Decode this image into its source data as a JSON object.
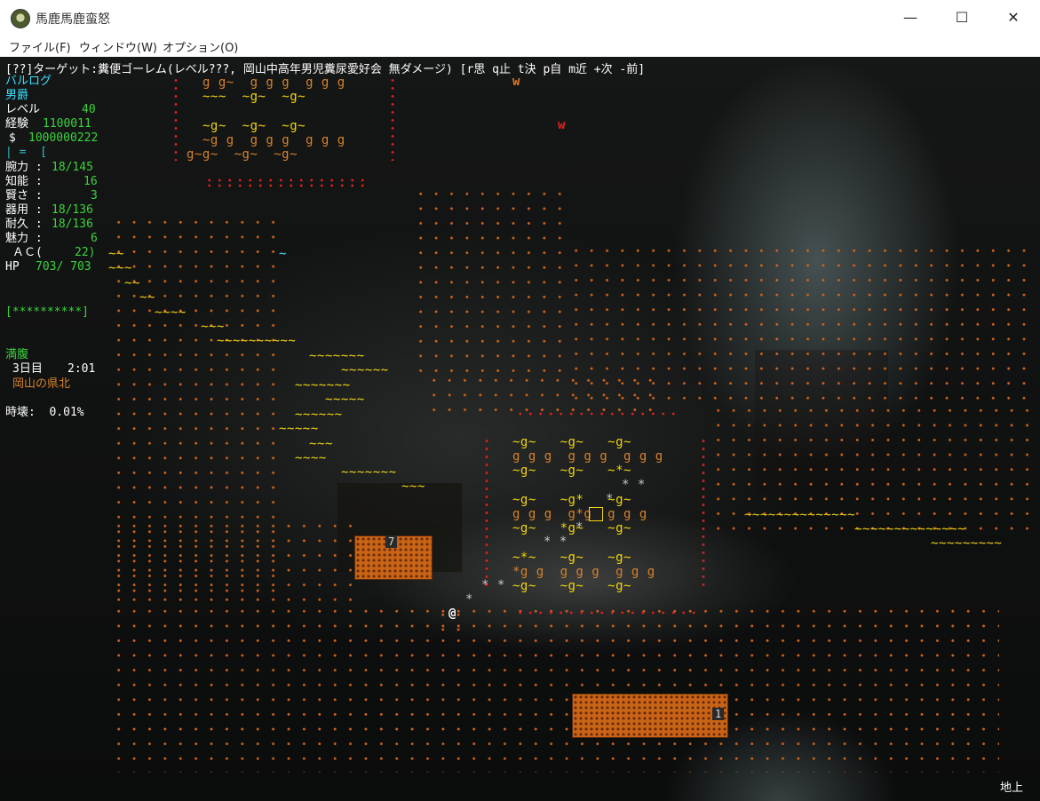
{
  "window": {
    "title": "馬鹿馬鹿蛮怒",
    "minimize_glyph": "—",
    "maximize_glyph": "☐",
    "close_glyph": "✕"
  },
  "menu": {
    "file": "ファイル(F)",
    "window": "ウィンドウ(W)",
    "options": "オプション(O)"
  },
  "header": {
    "target_line": "[??]ターゲット:糞便ゴーレム(レベル???, 岡山中高年男児糞尿愛好会 無ダメージ) [r思 q止 t決 p自 m近 +次 -前]"
  },
  "status": {
    "race": "バルログ",
    "title": "男爵",
    "level_label": "レベル",
    "level": "40",
    "exp_label": "経験",
    "exp": "1100011",
    "gold_label": "$",
    "gold": "1000000222",
    "equip_line": "| =  [",
    "str_label": "腕力 :",
    "str": "18/145",
    "int_label": "知能 :",
    "int": "16",
    "wis_label": "賢さ :",
    "wis": "3",
    "dex_label": "器用 :",
    "dex": "18/136",
    "con_label": "耐久 :",
    "con": "18/136",
    "chr_label": "魅力 :",
    "chr": "6",
    "ac_label": "ＡＣ(",
    "ac": "22)",
    "hp_label": "HP",
    "hp": "703/ 703",
    "health_bar": "[**********]",
    "hunger": "満腹",
    "day": "3日目",
    "time": "2:01",
    "location": "岡山の県北",
    "time_decay": "時壊:  0.01%",
    "depth": "地上"
  },
  "map": {
    "player_glyph": "@",
    "monster_glyph_w": "w",
    "rubble_tag_a": "7",
    "rubble_tag_b": "1",
    "colors": {
      "floor": "#d0641c",
      "golem": "#d8822b",
      "water": "#f2d40f",
      "wall_dots": "#e02020",
      "status_cyan": "#3ce0ff",
      "status_green": "#3cd23c"
    },
    "top_block": [
      "g g~  g g g  g g g",
      "~~~  ~g~  ~g~",
      "",
      "",
      "~g~  ~g~  ~g~",
      "~g g  g g g  g g g",
      "g~g~  ~g~  ~g~"
    ],
    "mid_block": [
      "~g~   ~g~   ~g~",
      "g g g  g g g  g g g",
      "~g~   ~g~   ~*~",
      "",
      "~g~   ~g*   ~g~",
      "g g g  g*g  g g g",
      "~g~   *g~   ~g~",
      "",
      "~*~   ~g~   ~g~",
      "*g g  g g g  g g g",
      "~g~   ~g~   ~g~"
    ],
    "river": [
      "~~",
      "~~~",
      "~~",
      "~~",
      "~~~~",
      "~~~",
      "~~~~~~~~~~",
      "~~~~~~~",
      "~~~~~~",
      "~~~~~~~",
      "~~~~~",
      "~~~~~~",
      "~~~~~",
      "~~~",
      "~~~~",
      "~~~~~~~",
      "~~~"
    ],
    "river_right": [
      "~~~~~~~~~~~~~~",
      "~~~~~~~~~~~",
      "~~~~~~~~~"
    ],
    "lake_glyph": "~",
    "stars": [
      "* *",
      "*",
      "*",
      "* *",
      "* *",
      "*"
    ]
  }
}
